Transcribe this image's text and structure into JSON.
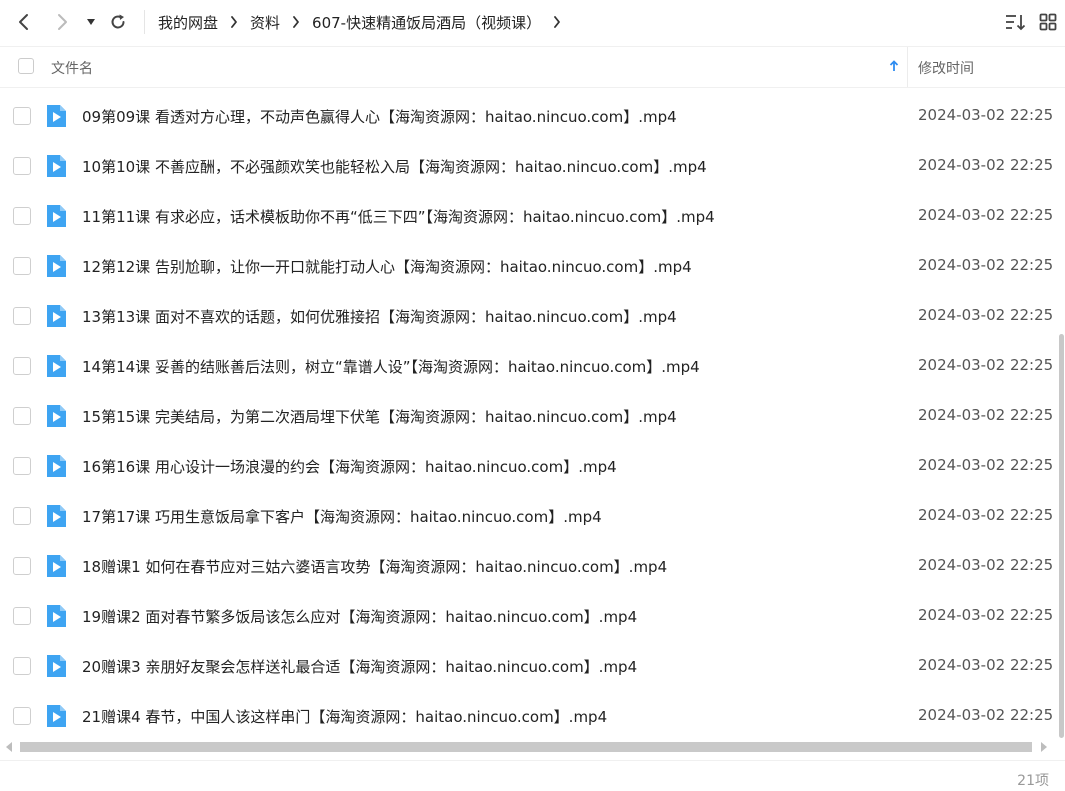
{
  "breadcrumb": [
    "我的网盘",
    "资料",
    "607-快速精通饭局酒局（视频课）"
  ],
  "columns": {
    "name": "文件名",
    "modified": "修改时间"
  },
  "files": [
    {
      "name": "09第09课 看透对方心理，不动声色赢得人心【海淘资源网：haitao.nincuo.com】.mp4",
      "time": "2024-03-02 22:25"
    },
    {
      "name": "10第10课 不善应酬，不必强颜欢笑也能轻松入局【海淘资源网：haitao.nincuo.com】.mp4",
      "time": "2024-03-02 22:25"
    },
    {
      "name": "11第11课 有求必应，话术模板助你不再“低三下四”【海淘资源网：haitao.nincuo.com】.mp4",
      "time": "2024-03-02 22:25"
    },
    {
      "name": "12第12课 告别尬聊，让你一开口就能打动人心【海淘资源网：haitao.nincuo.com】.mp4",
      "time": "2024-03-02 22:25"
    },
    {
      "name": "13第13课 面对不喜欢的话题，如何优雅接招【海淘资源网：haitao.nincuo.com】.mp4",
      "time": "2024-03-02 22:25"
    },
    {
      "name": "14第14课 妥善的结账善后法则，树立“靠谱人设”【海淘资源网：haitao.nincuo.com】.mp4",
      "time": "2024-03-02 22:25"
    },
    {
      "name": "15第15课 完美结局，为第二次酒局埋下伏笔【海淘资源网：haitao.nincuo.com】.mp4",
      "time": "2024-03-02 22:25"
    },
    {
      "name": "16第16课 用心设计一场浪漫的约会【海淘资源网：haitao.nincuo.com】.mp4",
      "time": "2024-03-02 22:25"
    },
    {
      "name": "17第17课 巧用生意饭局拿下客户【海淘资源网：haitao.nincuo.com】.mp4",
      "time": "2024-03-02 22:25"
    },
    {
      "name": "18赠课1 如何在春节应对三姑六婆语言攻势【海淘资源网：haitao.nincuo.com】.mp4",
      "time": "2024-03-02 22:25"
    },
    {
      "name": "19赠课2 面对春节繁多饭局该怎么应对【海淘资源网：haitao.nincuo.com】.mp4",
      "time": "2024-03-02 22:25"
    },
    {
      "name": "20赠课3 亲朋好友聚会怎样送礼最合适【海淘资源网：haitao.nincuo.com】.mp4",
      "time": "2024-03-02 22:25"
    },
    {
      "name": "21赠课4 春节，中国人该这样串门【海淘资源网：haitao.nincuo.com】.mp4",
      "time": "2024-03-02 22:25"
    }
  ],
  "status": {
    "count": "21项"
  },
  "icons": {
    "back": "chevron-left-icon",
    "forward": "chevron-right-icon",
    "history": "dropdown-triangle-icon",
    "refresh": "refresh-icon",
    "sort": "sort-icon",
    "view": "grid-view-icon",
    "file": "video-file-icon"
  },
  "colors": {
    "accent": "#2f8cf0",
    "file_icon": "#3ea4f2",
    "scrollbar": "#c8c8c8"
  }
}
